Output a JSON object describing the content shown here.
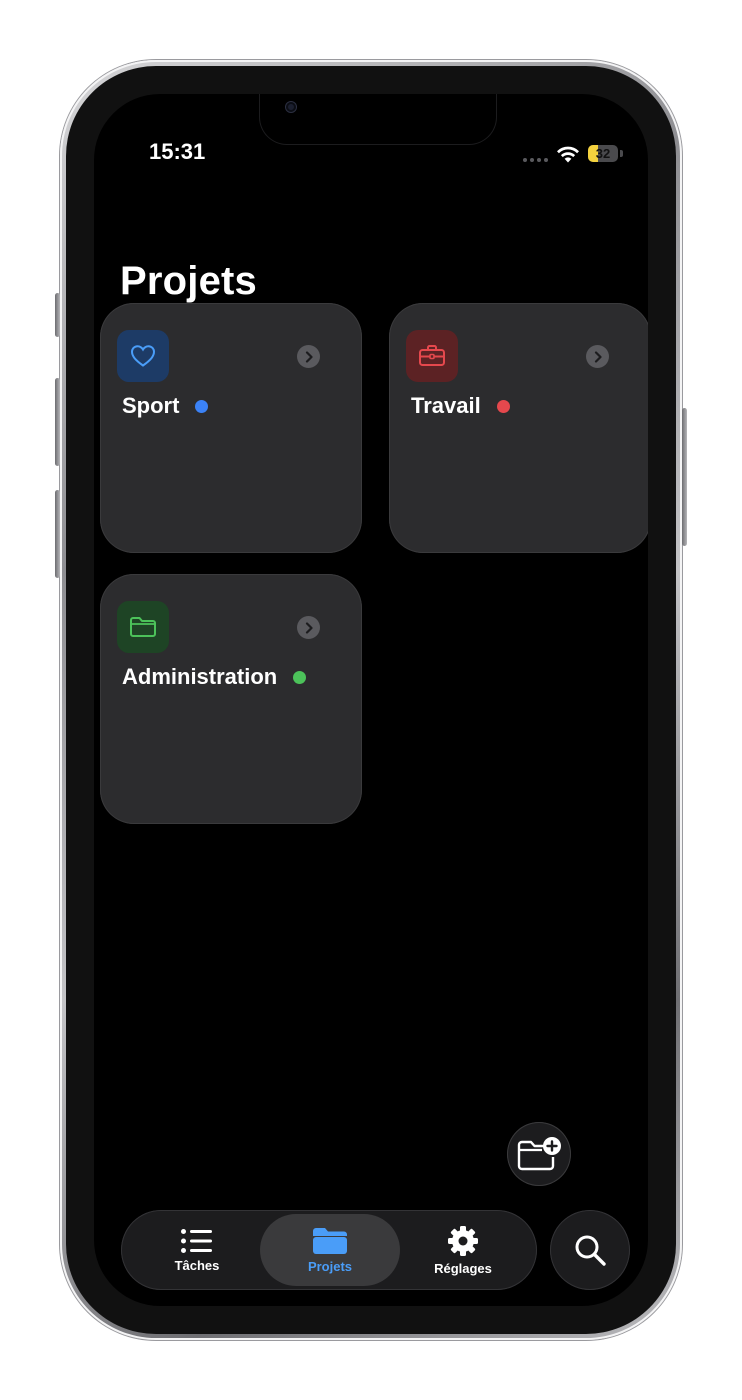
{
  "status_bar": {
    "time": "15:31",
    "battery_level": "32",
    "battery_fraction": 0.32,
    "battery_color": "#f4d23e"
  },
  "page": {
    "title": "Projets"
  },
  "projects": [
    {
      "name": "Sport",
      "icon": "heart-icon",
      "color": "#3b82f6"
    },
    {
      "name": "Travail",
      "icon": "briefcase-icon",
      "color": "#e5484d"
    },
    {
      "name": "Administration",
      "icon": "folder-icon",
      "color": "#4cc25a"
    }
  ],
  "fab": {
    "icon": "folder-add-icon"
  },
  "tabbar": {
    "tabs": [
      {
        "label": "Tâches",
        "icon": "list-icon",
        "active": false
      },
      {
        "label": "Projets",
        "icon": "folder-fill-icon",
        "active": true
      },
      {
        "label": "Réglages",
        "icon": "gear-icon",
        "active": false
      }
    ],
    "accent": "#4a9df8"
  },
  "search": {
    "icon": "search-icon"
  }
}
